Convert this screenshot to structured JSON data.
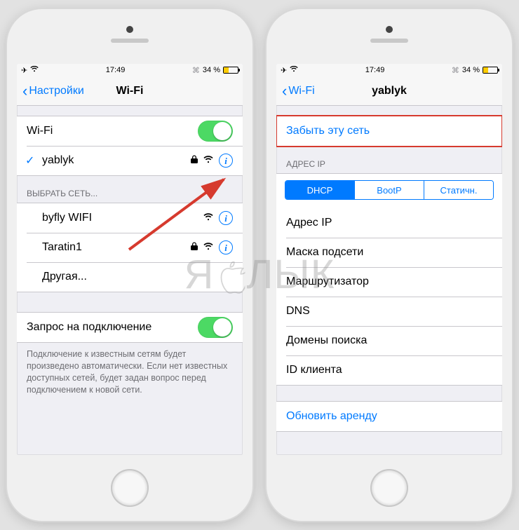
{
  "status": {
    "time": "17:49",
    "battery_text": "34 %",
    "bt_icon": "bluetooth-icon",
    "airplane_icon": "airplane-icon"
  },
  "phone1": {
    "nav": {
      "back": "Настройки",
      "title": "Wi-Fi"
    },
    "wifi_toggle_label": "Wi-Fi",
    "connected_network": "yablyk",
    "choose_header": "ВЫБРАТЬ СЕТЬ...",
    "networks": [
      {
        "name": "byfly WIFI",
        "locked": false
      },
      {
        "name": "Taratin1",
        "locked": true
      }
    ],
    "other_label": "Другая...",
    "ask_label": "Запрос на подключение",
    "ask_footer": "Подключение к известным сетям будет произведено автоматически. Если нет известных доступных сетей, будет задан вопрос перед подключением к новой сети."
  },
  "phone2": {
    "nav": {
      "back": "Wi-Fi",
      "title": "yablyk"
    },
    "forget_label": "Забыть эту сеть",
    "ip_header": "АДРЕС IP",
    "seg": {
      "dhcp": "DHCP",
      "bootp": "BootP",
      "static": "Статичн."
    },
    "rows": {
      "ip": "Адрес IP",
      "mask": "Маска подсети",
      "router": "Маршрутизатор",
      "dns": "DNS",
      "search": "Домены поиска",
      "client": "ID клиента"
    },
    "renew": "Обновить аренду"
  },
  "watermark_text_left": "Я",
  "watermark_text_right": "ЛЫК"
}
